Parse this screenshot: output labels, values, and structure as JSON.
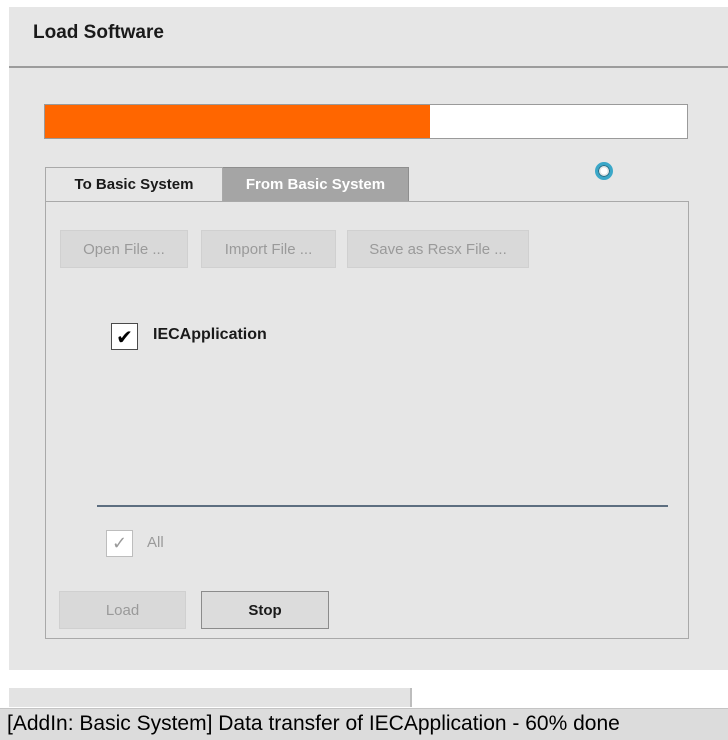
{
  "dialog": {
    "title": "Load Software"
  },
  "progress": {
    "percent": 60,
    "fill_color": "#ff6600"
  },
  "tabs": [
    {
      "label": "To Basic System",
      "selected": false
    },
    {
      "label": "From Basic System",
      "selected": true
    }
  ],
  "toolbar": {
    "open_label": "Open File ...",
    "import_label": "Import File ...",
    "save_label": "Save as Resx File ..."
  },
  "items": [
    {
      "label": "IECApplication",
      "checked": true
    }
  ],
  "select_all": {
    "label": "All",
    "checked": true
  },
  "actions": {
    "load_label": "Load",
    "stop_label": "Stop"
  },
  "status_bar": {
    "text": "[AddIn: Basic System] Data transfer of IECApplication - 60% done"
  },
  "icons": {
    "busy": "loading-spinner-icon",
    "check": "check-icon"
  }
}
